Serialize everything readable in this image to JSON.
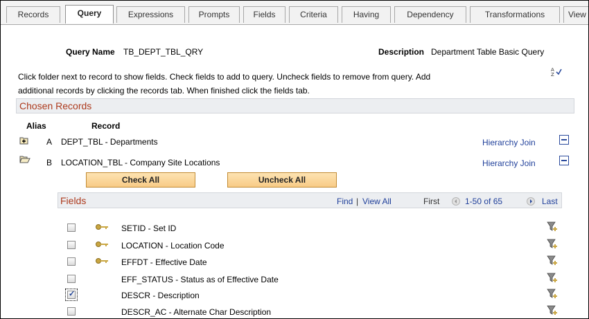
{
  "tabs": [
    {
      "label": "Records",
      "active": false
    },
    {
      "label": "Query",
      "active": true
    },
    {
      "label": "Expressions",
      "active": false
    },
    {
      "label": "Prompts",
      "active": false
    },
    {
      "label": "Fields",
      "active": false
    },
    {
      "label": "Criteria",
      "active": false
    },
    {
      "label": "Having",
      "active": false
    },
    {
      "label": "Dependency",
      "active": false
    },
    {
      "label": "Transformations",
      "active": false
    },
    {
      "label": "View",
      "active": false
    }
  ],
  "query": {
    "name_label": "Query Name",
    "name_value": "TB_DEPT_TBL_QRY",
    "description_label": "Description",
    "description_value": "Department Table Basic Query"
  },
  "instructions": {
    "line1": "Click folder next to record to show fields. Check fields to add to query. Uncheck fields to remove from query. Add",
    "line2": "additional records by clicking the records tab. When finished click the fields tab."
  },
  "chosen_records": {
    "title": "Chosen Records",
    "col_alias": "Alias",
    "col_record": "Record",
    "records": [
      {
        "alias": "A",
        "name": "DEPT_TBL - Departments",
        "link": "Hierarchy Join",
        "folder": "plus"
      },
      {
        "alias": "B",
        "name": "LOCATION_TBL - Company Site Locations",
        "link": "Hierarchy Join",
        "folder": "open"
      }
    ]
  },
  "buttons": {
    "check_all": "Check All",
    "uncheck_all": "Uncheck All"
  },
  "fields": {
    "title": "Fields",
    "find": "Find",
    "separator": "|",
    "view_all": "View All",
    "first": "First",
    "range": "1-50 of 65",
    "last": "Last",
    "rows": [
      {
        "name": "SETID - Set ID",
        "key": true,
        "checked": false
      },
      {
        "name": "LOCATION - Location Code",
        "key": true,
        "checked": false
      },
      {
        "name": "EFFDT - Effective Date",
        "key": true,
        "checked": false
      },
      {
        "name": "EFF_STATUS - Status as of Effective Date",
        "key": false,
        "checked": false
      },
      {
        "name": "DESCR - Description",
        "key": false,
        "checked": true
      },
      {
        "name": "DESCR_AC - Alternate Char Description",
        "key": false,
        "checked": false
      }
    ]
  },
  "colors": {
    "section_title": "#ad3a1d",
    "link": "#1f3f9a",
    "button_fill": "#f8cb86"
  }
}
